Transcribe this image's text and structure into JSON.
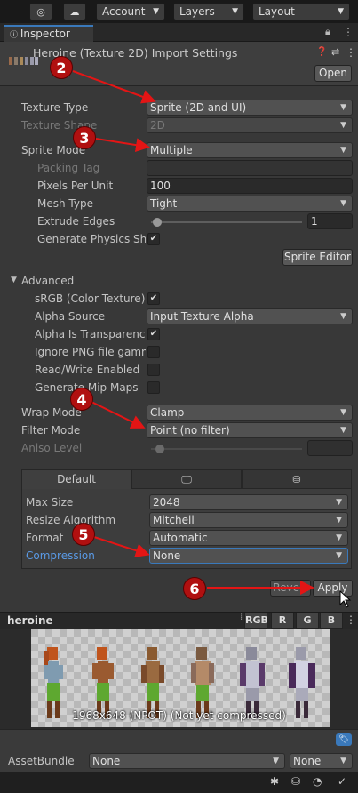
{
  "toolbar": {
    "account": "Account",
    "layers": "Layers",
    "layout": "Layout"
  },
  "tab": {
    "label": "Inspector"
  },
  "header": {
    "title": "Heroine (Texture 2D) Import Settings",
    "open_button": "Open"
  },
  "fields": {
    "texture_type": {
      "label": "Texture Type",
      "value": "Sprite (2D and UI)"
    },
    "texture_shape": {
      "label": "Texture Shape",
      "value": "2D"
    },
    "sprite_mode": {
      "label": "Sprite Mode",
      "value": "Multiple"
    },
    "packing_tag": {
      "label": "Packing Tag",
      "value": ""
    },
    "pixels_per_unit": {
      "label": "Pixels Per Unit",
      "value": "100"
    },
    "mesh_type": {
      "label": "Mesh Type",
      "value": "Tight"
    },
    "extrude_edges": {
      "label": "Extrude Edges",
      "value": "1"
    },
    "generate_physics": {
      "label": "Generate Physics Shape",
      "checked": true
    },
    "sprite_editor": "Sprite Editor",
    "advanced": "Advanced",
    "srgb": {
      "label": "sRGB (Color Texture)",
      "checked": true
    },
    "alpha_source": {
      "label": "Alpha Source",
      "value": "Input Texture Alpha"
    },
    "alpha_transparency": {
      "label": "Alpha Is Transparency",
      "checked": true
    },
    "ignore_png": {
      "label": "Ignore PNG file gamma",
      "checked": false
    },
    "read_write": {
      "label": "Read/Write Enabled",
      "checked": false
    },
    "mip_maps": {
      "label": "Generate Mip Maps",
      "checked": false
    },
    "wrap_mode": {
      "label": "Wrap Mode",
      "value": "Clamp"
    },
    "filter_mode": {
      "label": "Filter Mode",
      "value": "Point (no filter)"
    },
    "aniso_level": {
      "label": "Aniso Level"
    }
  },
  "platform": {
    "default_tab": "Default",
    "max_size": {
      "label": "Max Size",
      "value": "2048"
    },
    "resize": {
      "label": "Resize Algorithm",
      "value": "Mitchell"
    },
    "format": {
      "label": "Format",
      "value": "Automatic"
    },
    "compression": {
      "label": "Compression",
      "value": "None"
    }
  },
  "actions": {
    "revert": "Revert",
    "apply": "Apply"
  },
  "preview": {
    "name": "heroine",
    "channels": [
      "RGB",
      "R",
      "G",
      "B"
    ],
    "info": "1968x648 (NPOT) (Not yet compressed)"
  },
  "assetbundle": {
    "label": "AssetBundle",
    "name": "None",
    "variant": "None"
  },
  "markers": [
    "2",
    "3",
    "4",
    "5",
    "6"
  ],
  "colors": {
    "accent": "#3a79bb",
    "marker": "#b01010",
    "arrow": "#e31515",
    "link": "#5a9ae6"
  }
}
